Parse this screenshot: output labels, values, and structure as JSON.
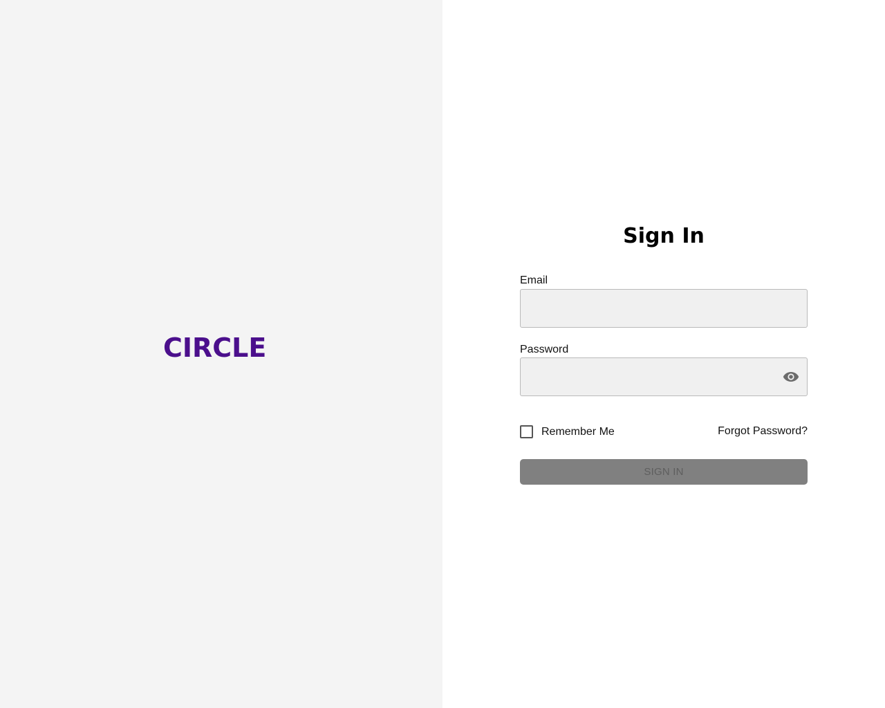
{
  "brand": {
    "logo_text": "CIRCLE",
    "color": "#4b0f8c"
  },
  "form": {
    "title": "Sign In",
    "email": {
      "label": "Email",
      "value": "",
      "placeholder": ""
    },
    "password": {
      "label": "Password",
      "value": "",
      "placeholder": "",
      "visibility_icon": "eye-icon"
    },
    "remember_me": {
      "label": "Remember Me",
      "checked": false
    },
    "forgot_password_label": "Forgot Password?",
    "submit": {
      "label": "SIGN IN",
      "disabled": true,
      "background": "#808080"
    }
  },
  "colors": {
    "left_panel_bg": "#f4f4f4",
    "right_panel_bg": "#ffffff",
    "input_bg": "#f0f0f0"
  }
}
